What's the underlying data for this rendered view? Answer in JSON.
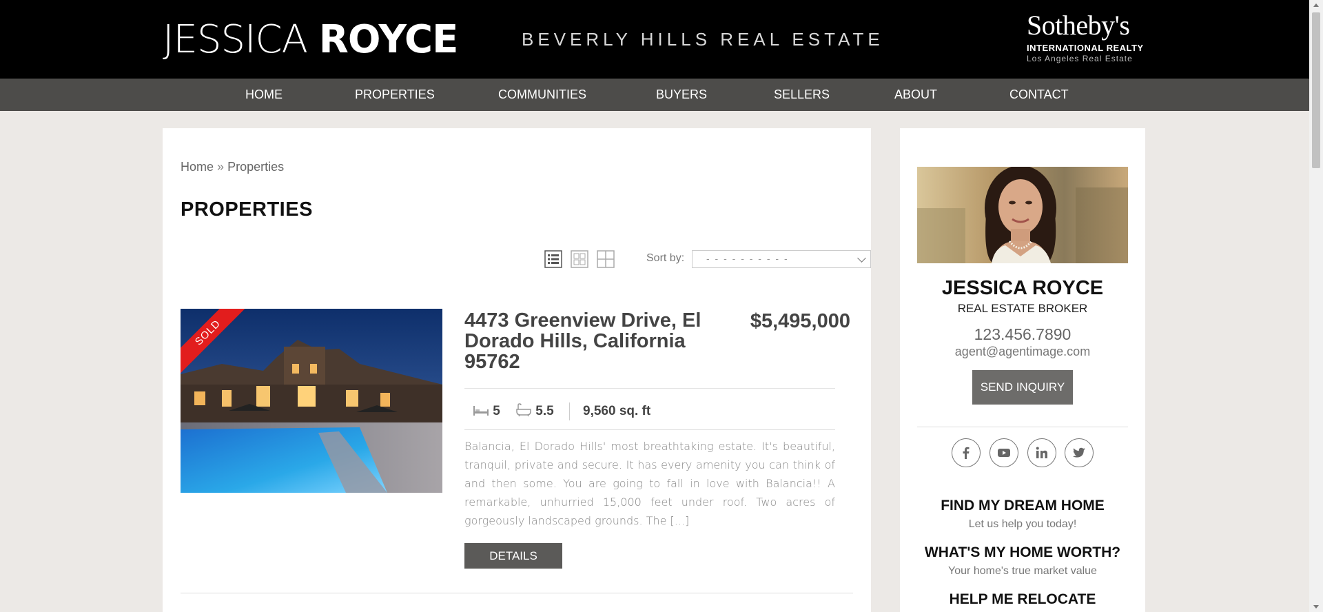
{
  "header": {
    "logo_first": "JESSICA",
    "logo_last": "ROYCE",
    "tagline": "BEVERLY HILLS REAL ESTATE",
    "brand_main": "Sotheby's",
    "brand_sub": "INTERNATIONAL REALTY",
    "brand_sub2": "Los Angeles Real Estate"
  },
  "nav": {
    "items": [
      {
        "label": "HOME"
      },
      {
        "label": "PROPERTIES"
      },
      {
        "label": "COMMUNITIES"
      },
      {
        "label": "BUYERS"
      },
      {
        "label": "SELLERS"
      },
      {
        "label": "ABOUT"
      },
      {
        "label": "CONTACT"
      }
    ]
  },
  "breadcrumb": {
    "home": "Home",
    "separator": "»",
    "current": "Properties"
  },
  "page_title": "PROPERTIES",
  "toolbar": {
    "views": [
      "list-view-icon",
      "grid-view-icon",
      "map-view-icon"
    ],
    "active_view": "list",
    "sort_label": "Sort by:",
    "sort_value": "- - - - - - - - - -"
  },
  "listing": {
    "badge": "SOLD",
    "address": "4473 Greenview Drive, El Dorado Hills, California 95762",
    "price": "$5,495,000",
    "beds": "5",
    "baths": "5.5",
    "sqft": "9,560 sq. ft",
    "excerpt": "Balancia, El Dorado Hills' most breathtaking estate. It's beautiful, tranquil, private and secure. It has every amenity you can think of and then some. You are going to fall in love with Balancia!! A remarkable, unhurried 15,000 feet under roof. Two acres of gorgeously landscaped grounds. The [...]",
    "details_label": "DETAILS"
  },
  "agent": {
    "name": "JESSICA ROYCE",
    "title": "REAL ESTATE BROKER",
    "phone": "123.456.7890",
    "email": "agent@agentimage.com",
    "inquiry_label": "SEND INQUIRY",
    "social": [
      "facebook-icon",
      "youtube-icon",
      "linkedin-icon",
      "twitter-icon"
    ]
  },
  "cta": [
    {
      "title": "FIND MY DREAM HOME",
      "subtitle": "Let us help you today!"
    },
    {
      "title": "WHAT'S MY HOME WORTH?",
      "subtitle": "Your home's true market value"
    },
    {
      "title": "HELP ME RELOCATE",
      "subtitle": ""
    }
  ],
  "colors": {
    "header_bg": "#000000",
    "nav_bg": "#4d4c4a",
    "page_bg": "#ece9e6",
    "sold_badge": "#e21d1d",
    "button_bg": "#5b5a58"
  }
}
